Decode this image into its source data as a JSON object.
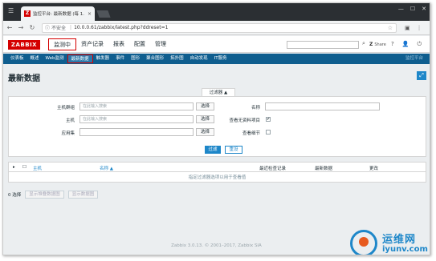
{
  "browser": {
    "tab_title": "监控平台: 最新数据 (每 1...",
    "tab_close": "×",
    "url_prefix": "不安全",
    "url": "10.0.0.61/zabbix/latest.php?ddreset=1",
    "window_controls": [
      "—",
      "☐",
      "✕"
    ]
  },
  "header": {
    "logo": "ZABBIX",
    "nav": [
      {
        "label": "监测中",
        "active": true
      },
      {
        "label": "资产记录",
        "active": false
      },
      {
        "label": "报表",
        "active": false
      },
      {
        "label": "配置",
        "active": false
      },
      {
        "label": "管理",
        "active": false
      }
    ],
    "share": "Share",
    "help": "?",
    "user": "👤",
    "logout": "⏻"
  },
  "subnav": {
    "items": [
      {
        "label": "仪表板",
        "active": false
      },
      {
        "label": "概述",
        "active": false
      },
      {
        "label": "Web监测",
        "active": false
      },
      {
        "label": "最新数据",
        "active": true
      },
      {
        "label": "触发器",
        "active": false
      },
      {
        "label": "事件",
        "active": false
      },
      {
        "label": "图形",
        "active": false
      },
      {
        "label": "聚合图形",
        "active": false
      },
      {
        "label": "拓扑图",
        "active": false
      },
      {
        "label": "自动发现",
        "active": false
      },
      {
        "label": "IT服务",
        "active": false
      }
    ],
    "right": "监控平台"
  },
  "page": {
    "title": "最新数据",
    "fullscreen": "⤢"
  },
  "filter": {
    "tab_label": "过滤器 ▲",
    "host_groups_label": "主机群组",
    "host_groups_placeholder": "在此输入搜索",
    "hosts_label": "主机",
    "hosts_placeholder": "在此输入搜索",
    "application_label": "应用集",
    "application_value": "",
    "select_label": "选择",
    "name_label": "名称",
    "show_without_data_label": "查看无资料项目",
    "show_without_data_checked": true,
    "show_details_label": "查看细节",
    "show_details_checked": false,
    "filter_button": "过滤",
    "reset_button": "重设"
  },
  "table": {
    "columns": [
      "主机",
      "名称 ▲",
      "最近检查记录",
      "最新数据",
      "更改"
    ],
    "empty_message": "指定过滤器选项以用于查看值"
  },
  "footer": {
    "selected": "0 选择",
    "actions": [
      "显示堆叠数据图",
      "显示数据图"
    ],
    "copyright": "Zabbix 3.0.13. © 2001–2017, Zabbix SIA"
  },
  "watermark": {
    "cn": "运维网",
    "en": "iyunv.com"
  }
}
